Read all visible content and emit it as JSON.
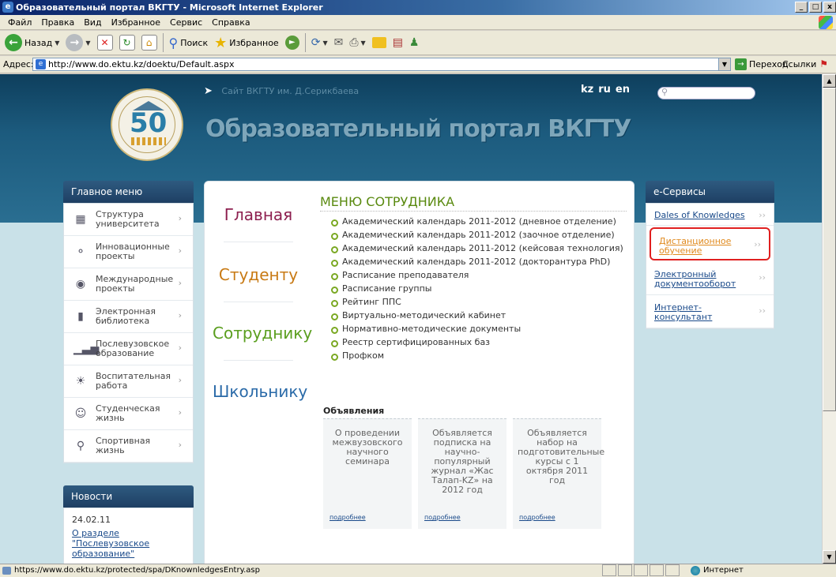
{
  "window": {
    "title": "Образовательный портал ВКГТУ - Microsoft Internet Explorer",
    "min": "_",
    "max": "□",
    "close": "x"
  },
  "menubar": [
    "Файл",
    "Правка",
    "Вид",
    "Избранное",
    "Сервис",
    "Справка"
  ],
  "toolbar": {
    "back": "Назад",
    "search": "Поиск",
    "favorites": "Избранное"
  },
  "address": {
    "label": "Адрес:",
    "url": "http://www.do.ektu.kz/doektu/Default.aspx",
    "go": "Переход",
    "links": "Ссылки"
  },
  "site": {
    "topnav": "Сайт ВКГТУ им. Д.Серикбаева",
    "langs": [
      "kz",
      "ru",
      "en"
    ],
    "title": "Образовательный портал ВКГТУ",
    "logo_text": "50"
  },
  "mainmenu": {
    "title": "Главное меню",
    "items": [
      {
        "label": "Структура университета",
        "icon": "org-chart-icon"
      },
      {
        "label": "Инновационные проекты",
        "icon": "lightbulb-icon"
      },
      {
        "label": "Международные проекты",
        "icon": "globe-icon"
      },
      {
        "label": "Электронная библиотека",
        "icon": "library-icon"
      },
      {
        "label": "Послевузовское образование",
        "icon": "bar-chart-icon"
      },
      {
        "label": "Воспитательная работа",
        "icon": "sun-icon"
      },
      {
        "label": "Студенческая жизнь",
        "icon": "smiley-icon"
      },
      {
        "label": "Спортивная жизнь",
        "icon": "trophy-icon"
      }
    ]
  },
  "news": {
    "title": "Новости",
    "date": "24.02.11",
    "link": "О разделе \"Послевузовское образование\""
  },
  "sections": [
    "Главная",
    "Студенту",
    "Сотруднику",
    "Школьнику"
  ],
  "staffmenu": {
    "title": "МЕНЮ СОТРУДНИКА",
    "items": [
      "Академический календарь 2011-2012 (дневное отделение)",
      "Академический календарь 2011-2012 (заочное отделение)",
      "Академический календарь 2011-2012 (кейсовая технология)",
      "Академический календарь 2011-2012 (докторантура PhD)",
      "Расписание преподавателя",
      "Расписание группы",
      "Рейтинг ППС",
      "Виртуально-методический кабинет",
      "Нормативно-методические документы",
      "Реестр сертифицированных баз",
      "Профком"
    ]
  },
  "announcements": {
    "title": "Объявления",
    "cards": [
      {
        "text": "О проведении межвузовского научного семинара",
        "more": "подробнее"
      },
      {
        "text": "Объявляется подписка на научно-популярный журнал «Жас Талап-KZ» на 2012 год",
        "more": "подробнее"
      },
      {
        "text": "Объявляется набор на подготовительные курсы с 1 октября 2011 год",
        "more": "подробнее"
      }
    ]
  },
  "eservices": {
    "title": "e-Сервисы",
    "items": [
      {
        "label": "Dales of Knowledges"
      },
      {
        "label": "Дистанционное обучение"
      },
      {
        "label": "Электронный документооборот"
      },
      {
        "label": "Интернет-консультант"
      }
    ]
  },
  "status": {
    "text": "https://www.do.ektu.kz/protected/spa/DKnownledgesEntry.asp",
    "zone": "Интернет"
  }
}
